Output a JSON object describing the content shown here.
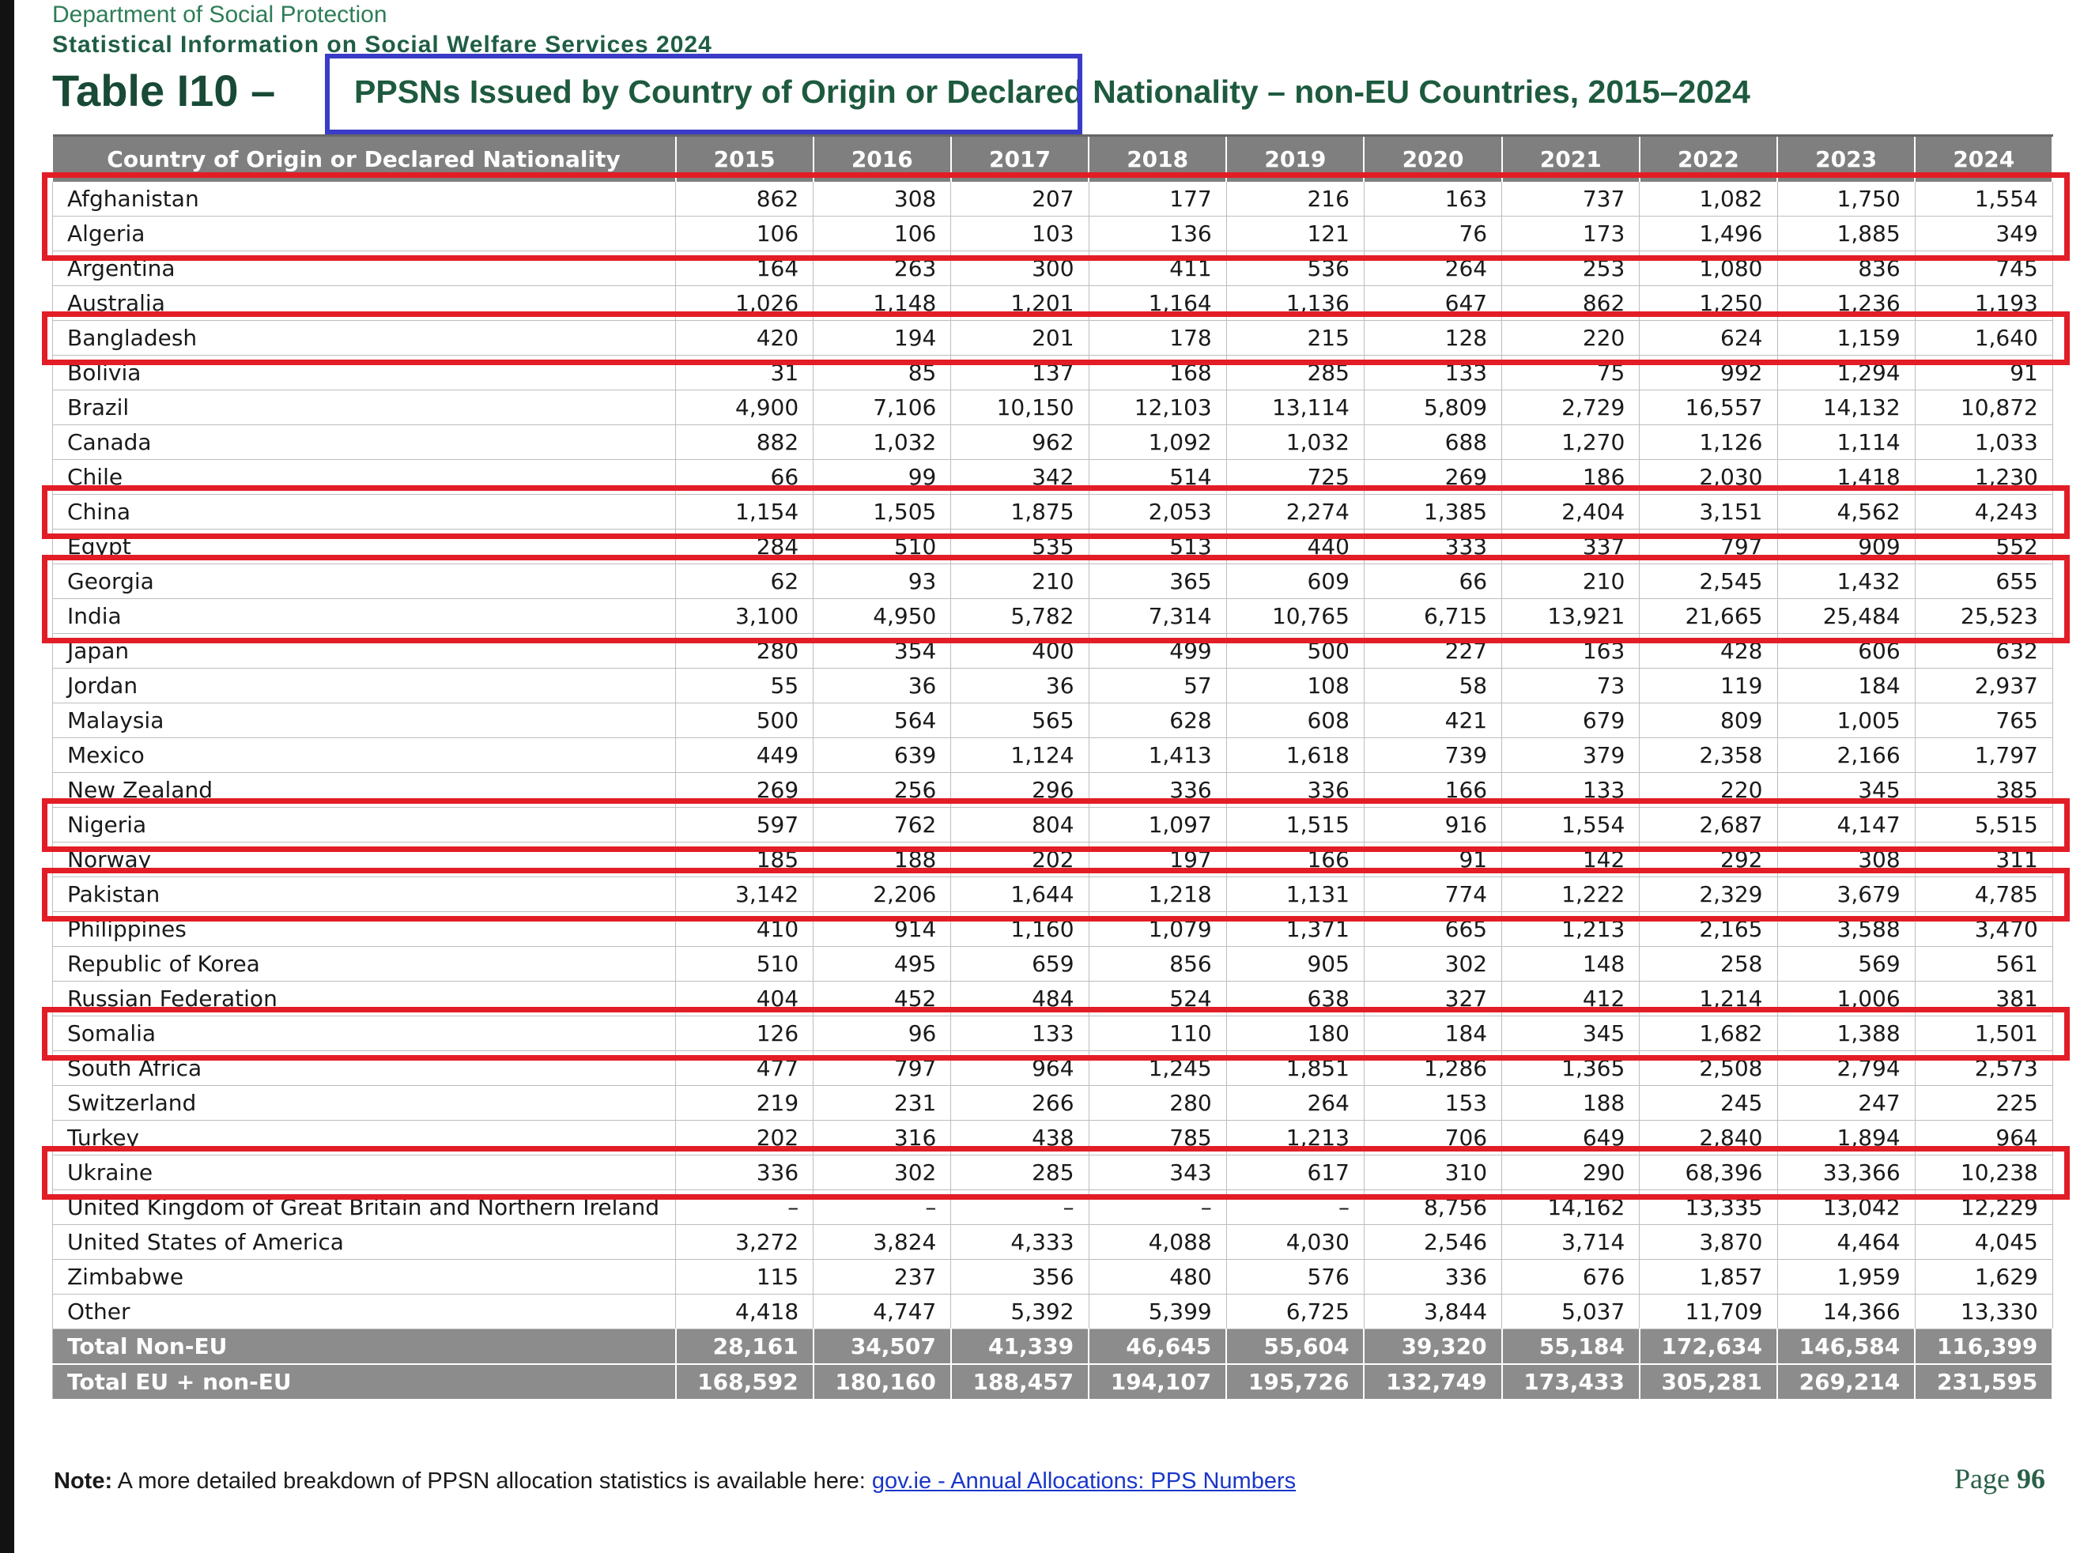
{
  "header": {
    "department": "Department of Social Protection",
    "publication": "Statistical Information on Social Welfare Services 2024",
    "table_number": "Table I10 –",
    "table_title": "PPSNs Issued by Country of Origin or Declared Nationality – non-EU Countries, 2015–2024"
  },
  "table": {
    "columns": [
      "Country of Origin or Declared Nationality",
      "2015",
      "2016",
      "2017",
      "2018",
      "2019",
      "2020",
      "2021",
      "2022",
      "2023",
      "2024"
    ],
    "rows": [
      [
        "Afghanistan",
        "862",
        "308",
        "207",
        "177",
        "216",
        "163",
        "737",
        "1,082",
        "1,750",
        "1,554"
      ],
      [
        "Algeria",
        "106",
        "106",
        "103",
        "136",
        "121",
        "76",
        "173",
        "1,496",
        "1,885",
        "349"
      ],
      [
        "Argentina",
        "164",
        "263",
        "300",
        "411",
        "536",
        "264",
        "253",
        "1,080",
        "836",
        "745"
      ],
      [
        "Australia",
        "1,026",
        "1,148",
        "1,201",
        "1,164",
        "1,136",
        "647",
        "862",
        "1,250",
        "1,236",
        "1,193"
      ],
      [
        "Bangladesh",
        "420",
        "194",
        "201",
        "178",
        "215",
        "128",
        "220",
        "624",
        "1,159",
        "1,640"
      ],
      [
        "Bolivia",
        "31",
        "85",
        "137",
        "168",
        "285",
        "133",
        "75",
        "992",
        "1,294",
        "91"
      ],
      [
        "Brazil",
        "4,900",
        "7,106",
        "10,150",
        "12,103",
        "13,114",
        "5,809",
        "2,729",
        "16,557",
        "14,132",
        "10,872"
      ],
      [
        "Canada",
        "882",
        "1,032",
        "962",
        "1,092",
        "1,032",
        "688",
        "1,270",
        "1,126",
        "1,114",
        "1,033"
      ],
      [
        "Chile",
        "66",
        "99",
        "342",
        "514",
        "725",
        "269",
        "186",
        "2,030",
        "1,418",
        "1,230"
      ],
      [
        "China",
        "1,154",
        "1,505",
        "1,875",
        "2,053",
        "2,274",
        "1,385",
        "2,404",
        "3,151",
        "4,562",
        "4,243"
      ],
      [
        "Egypt",
        "284",
        "510",
        "535",
        "513",
        "440",
        "333",
        "337",
        "797",
        "909",
        "552"
      ],
      [
        "Georgia",
        "62",
        "93",
        "210",
        "365",
        "609",
        "66",
        "210",
        "2,545",
        "1,432",
        "655"
      ],
      [
        "India",
        "3,100",
        "4,950",
        "5,782",
        "7,314",
        "10,765",
        "6,715",
        "13,921",
        "21,665",
        "25,484",
        "25,523"
      ],
      [
        "Japan",
        "280",
        "354",
        "400",
        "499",
        "500",
        "227",
        "163",
        "428",
        "606",
        "632"
      ],
      [
        "Jordan",
        "55",
        "36",
        "36",
        "57",
        "108",
        "58",
        "73",
        "119",
        "184",
        "2,937"
      ],
      [
        "Malaysia",
        "500",
        "564",
        "565",
        "628",
        "608",
        "421",
        "679",
        "809",
        "1,005",
        "765"
      ],
      [
        "Mexico",
        "449",
        "639",
        "1,124",
        "1,413",
        "1,618",
        "739",
        "379",
        "2,358",
        "2,166",
        "1,797"
      ],
      [
        "New Zealand",
        "269",
        "256",
        "296",
        "336",
        "336",
        "166",
        "133",
        "220",
        "345",
        "385"
      ],
      [
        "Nigeria",
        "597",
        "762",
        "804",
        "1,097",
        "1,515",
        "916",
        "1,554",
        "2,687",
        "4,147",
        "5,515"
      ],
      [
        "Norway",
        "185",
        "188",
        "202",
        "197",
        "166",
        "91",
        "142",
        "292",
        "308",
        "311"
      ],
      [
        "Pakistan",
        "3,142",
        "2,206",
        "1,644",
        "1,218",
        "1,131",
        "774",
        "1,222",
        "2,329",
        "3,679",
        "4,785"
      ],
      [
        "Philippines",
        "410",
        "914",
        "1,160",
        "1,079",
        "1,371",
        "665",
        "1,213",
        "2,165",
        "3,588",
        "3,470"
      ],
      [
        "Republic of Korea",
        "510",
        "495",
        "659",
        "856",
        "905",
        "302",
        "148",
        "258",
        "569",
        "561"
      ],
      [
        "Russian Federation",
        "404",
        "452",
        "484",
        "524",
        "638",
        "327",
        "412",
        "1,214",
        "1,006",
        "381"
      ],
      [
        "Somalia",
        "126",
        "96",
        "133",
        "110",
        "180",
        "184",
        "345",
        "1,682",
        "1,388",
        "1,501"
      ],
      [
        "South Africa",
        "477",
        "797",
        "964",
        "1,245",
        "1,851",
        "1,286",
        "1,365",
        "2,508",
        "2,794",
        "2,573"
      ],
      [
        "Switzerland",
        "219",
        "231",
        "266",
        "280",
        "264",
        "153",
        "188",
        "245",
        "247",
        "225"
      ],
      [
        "Turkey",
        "202",
        "316",
        "438",
        "785",
        "1,213",
        "706",
        "649",
        "2,840",
        "1,894",
        "964"
      ],
      [
        "Ukraine",
        "336",
        "302",
        "285",
        "343",
        "617",
        "310",
        "290",
        "68,396",
        "33,366",
        "10,238"
      ],
      [
        "United Kingdom of Great Britain and Northern Ireland",
        "–",
        "–",
        "–",
        "–",
        "–",
        "8,756",
        "14,162",
        "13,335",
        "13,042",
        "12,229"
      ],
      [
        "United States of America",
        "3,272",
        "3,824",
        "4,333",
        "4,088",
        "4,030",
        "2,546",
        "3,714",
        "3,870",
        "4,464",
        "4,045"
      ],
      [
        "Zimbabwe",
        "115",
        "237",
        "356",
        "480",
        "576",
        "336",
        "676",
        "1,857",
        "1,959",
        "1,629"
      ],
      [
        "Other",
        "4,418",
        "4,747",
        "5,392",
        "5,399",
        "6,725",
        "3,844",
        "5,037",
        "11,709",
        "14,366",
        "13,330"
      ]
    ],
    "totals": [
      [
        "Total Non-EU",
        "28,161",
        "34,507",
        "41,339",
        "46,645",
        "55,604",
        "39,320",
        "55,184",
        "172,634",
        "146,584",
        "116,399"
      ],
      [
        "Total EU + non-EU",
        "168,592",
        "180,160",
        "188,457",
        "194,107",
        "195,726",
        "132,749",
        "173,433",
        "305,281",
        "269,214",
        "231,595"
      ]
    ]
  },
  "highlights": {
    "title_box_color": "#3a3cc8",
    "row_box_color": "#e21d26",
    "highlighted_rows": [
      "Afghanistan",
      "Algeria",
      "Bangladesh",
      "China",
      "Georgia",
      "India",
      "Nigeria",
      "Pakistan",
      "Somalia",
      "Ukraine"
    ]
  },
  "footer": {
    "note_label": "Note:",
    "note_text": "A more detailed breakdown of PPSN allocation statistics is available here:",
    "link_text": "gov.ie - Annual Allocations: PPS Numbers",
    "page_label": "Page",
    "page_number": "96"
  }
}
